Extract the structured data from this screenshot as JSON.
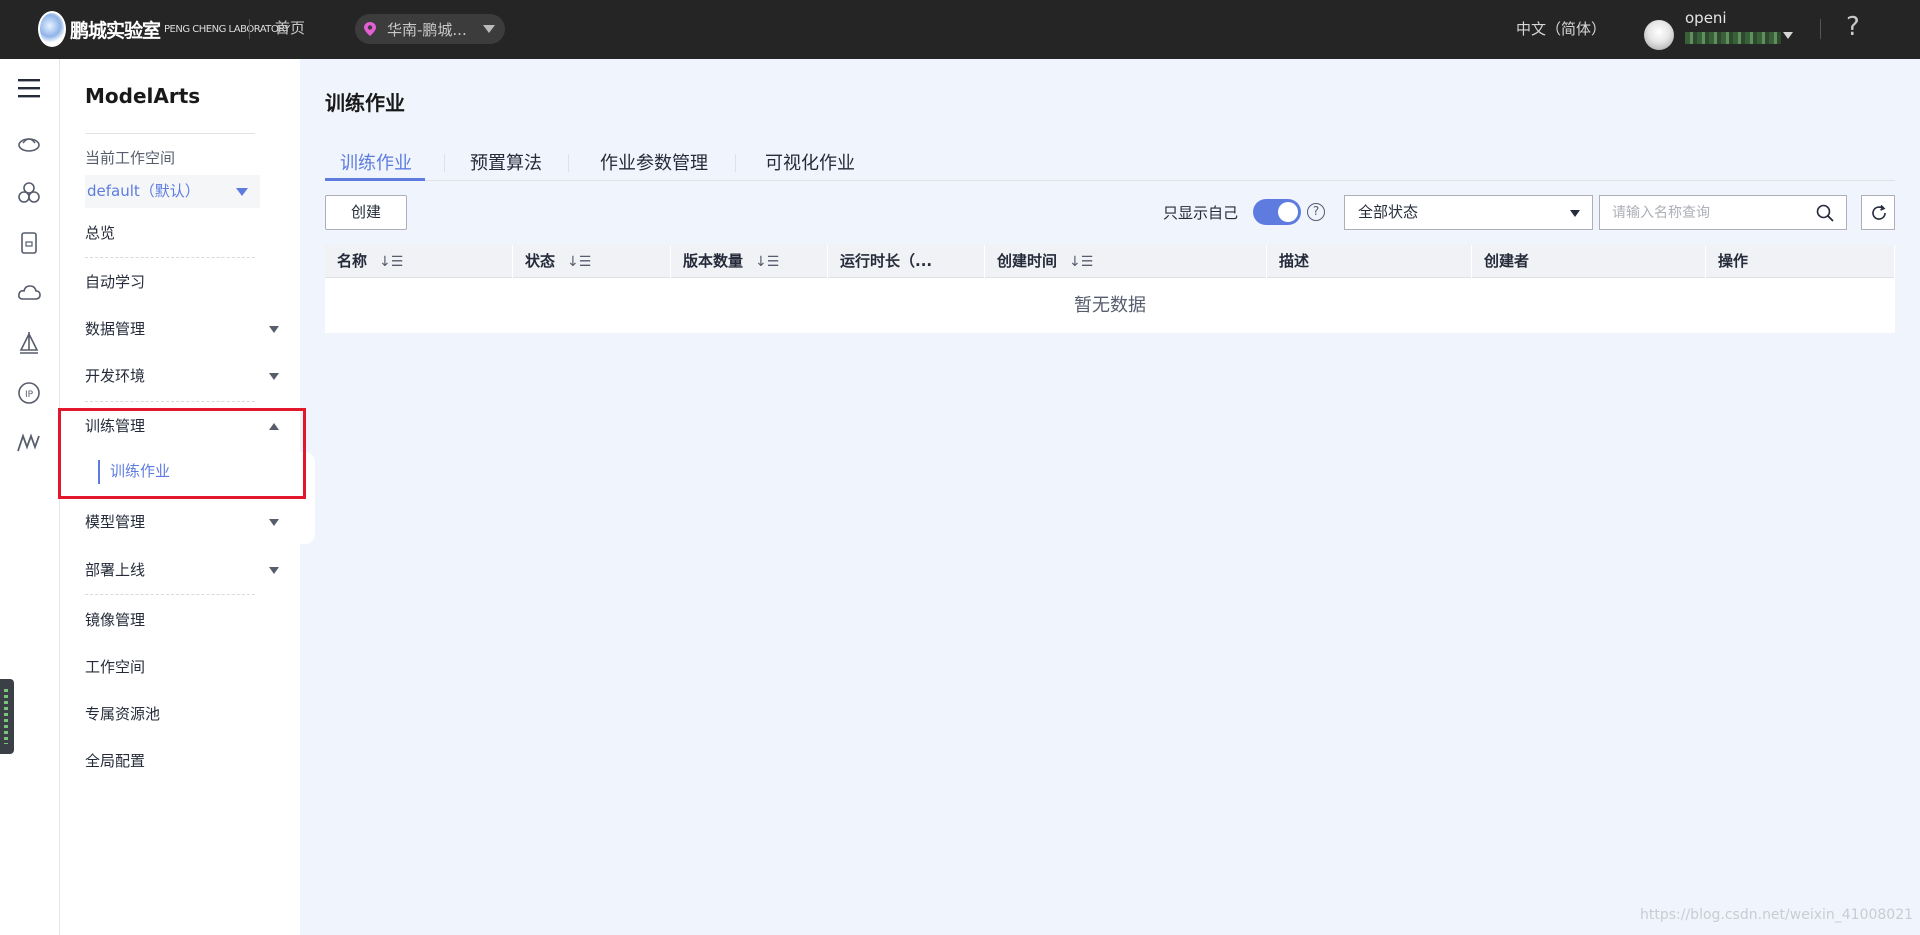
{
  "topbar": {
    "logo_text": "鹏城实验室",
    "logo_sub": "PENG CHENG LABORATORY",
    "home": "首页",
    "region": "华南-鹏城...",
    "language": "中文（简体）",
    "username": "openi",
    "help": "?"
  },
  "rail": {
    "icons": [
      "menu-icon",
      "cloud-hub-icon",
      "cluster-icon",
      "device-icon",
      "cloud-icon",
      "sail-icon",
      "ip-icon",
      "modelarts-icon"
    ]
  },
  "sidenav": {
    "title": "ModelArts",
    "workspace_label": "当前工作空间",
    "workspace_value": "default（默认）",
    "items": {
      "overview": "总览",
      "auto_learning": "自动学习",
      "data_mgmt": "数据管理",
      "dev_env": "开发环境",
      "training_mgmt": "训练管理",
      "training_jobs": "训练作业",
      "model_mgmt": "模型管理",
      "deploy": "部署上线",
      "image_mgmt": "镜像管理",
      "workspace": "工作空间",
      "dedicated_pool": "专属资源池",
      "global_config": "全局配置"
    }
  },
  "main": {
    "title": "训练作业",
    "tabs": [
      "训练作业",
      "预置算法",
      "作业参数管理",
      "可视化作业"
    ],
    "create_button": "创建",
    "only_me_label": "只显示自己",
    "status_filter": "全部状态",
    "search_placeholder": "请输入名称查询",
    "columns": [
      "名称",
      "状态",
      "版本数量",
      "运行时长（...",
      "创建时间",
      "描述",
      "创建者",
      "操作"
    ],
    "sort_glyph": "↓☰",
    "empty_text": "暂无数据"
  },
  "watermark": "https://blog.csdn.net/weixin_41008021",
  "colors": {
    "accent": "#5e7ce0",
    "topbar": "#252525",
    "highlight": "#e2172b"
  }
}
